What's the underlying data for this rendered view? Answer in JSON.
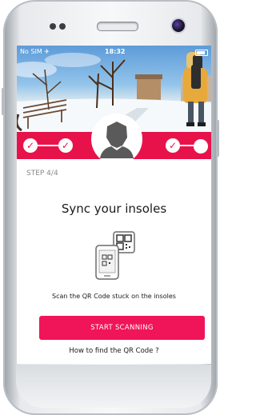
{
  "status_bar": {
    "carrier": "No SIM ✈",
    "time": "18:32"
  },
  "progress": {
    "completed_steps": 3,
    "total_steps": 4
  },
  "step": {
    "label": "STEP 4/4"
  },
  "page": {
    "title": "Sync your insoles",
    "instruction": "Scan the QR Code stuck on the insoles",
    "scan_button_label": "START SCANNING",
    "help_link": "How to find the QR Code ?"
  },
  "colors": {
    "accent": "#e8124a",
    "button": "#f01458",
    "avatar": "#5a5a5a"
  },
  "icons": {
    "avatar": "user-avatar-icon",
    "illustration": "qr-phone-scan-icon",
    "check": "check-icon"
  }
}
